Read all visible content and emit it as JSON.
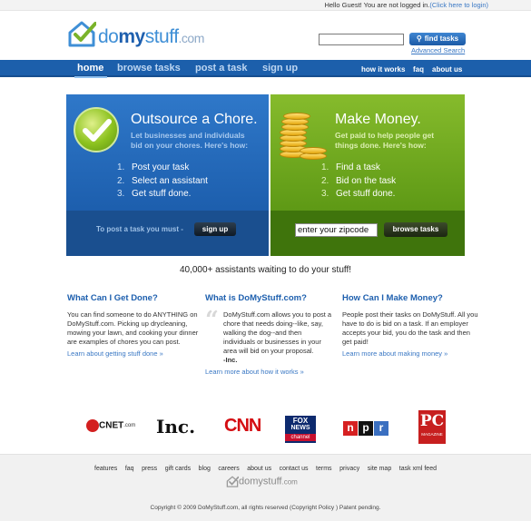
{
  "header": {
    "login_prefix": "Hello Guest! You are not logged in.",
    "login_link": "(Click here to login)",
    "logo": {
      "do": "do",
      "my": "my",
      "stuff": "stuff",
      "com": ".com"
    },
    "search_placeholder": "",
    "find_tasks_label": "find tasks",
    "advanced_search_label": "Advanced Search"
  },
  "nav": {
    "main": [
      "home",
      "browse tasks",
      "post a task",
      "sign up"
    ],
    "secondary": [
      "how it works",
      "faq",
      "about us"
    ],
    "active_index": 0
  },
  "hero_left": {
    "title": "Outsource a Chore.",
    "subtitle_line1": "Let businesses and individuals",
    "subtitle_line2": "bid on your chores. Here's how:",
    "steps": [
      "Post your task",
      "Select an assistant",
      "Get stuff done."
    ],
    "cta_label": "To post a task you must -",
    "button_label": "sign up"
  },
  "hero_right": {
    "title": "Make Money.",
    "subtitle_line1": "Get paid to help people get",
    "subtitle_line2": "things done. Here's how:",
    "steps": [
      "Find a task",
      "Bid on the task",
      "Get stuff done."
    ],
    "zip_value": "enter your zipcode",
    "button_label": "browse tasks"
  },
  "assistants_line": "40,000+ assistants waiting to do your stuff!",
  "columns": {
    "left": {
      "heading": "What Can I Get Done?",
      "body": "You can find someone to do ANYTHING on DoMyStuff.com. Picking up drycleaning, mowing your lawn, and cooking your dinner are examples of chores you can post.",
      "link": "Learn about getting stuff done »"
    },
    "middle": {
      "heading": "What is DoMyStuff.com?",
      "quote": "DoMyStuff.com allows you to post a chore that needs doing--like, say, walking the dog--and then individuals or businesses in your area will bid on your proposal.",
      "attribution": "-Inc.",
      "link": "Learn more about how it works »"
    },
    "right": {
      "heading": "How Can I Make Money?",
      "body": "People post their tasks on DoMyStuff. All you have to do is bid on a task. If an employer accepts your bid, you do the task and then get paid!",
      "link": "Learn more about making money »"
    }
  },
  "press": {
    "cnet": "CNET",
    "cnet_com": ".com",
    "inc": "Inc.",
    "cnn": "CNN",
    "fox_line1": "FOX",
    "fox_line2": "NEWS",
    "fox_line3": "channel",
    "npr": [
      "n",
      "p",
      "r"
    ],
    "pc": "PC",
    "pc_sub": "MAGAZINE"
  },
  "footer": {
    "links": [
      "features",
      "faq",
      "press",
      "gift cards",
      "blog",
      "careers",
      "about us",
      "contact us",
      "terms",
      "privacy",
      "site map",
      "task xml feed"
    ],
    "logo_text": "domystuff",
    "logo_com": ".com",
    "copyright": "Copyright © 2009 DoMyStuff.com, all rights reserved (Copyright Policy   ) Patent pending."
  },
  "colors": {
    "brand_blue": "#1c5fab",
    "brand_green": "#6aa81c",
    "link": "#3a78c4"
  }
}
